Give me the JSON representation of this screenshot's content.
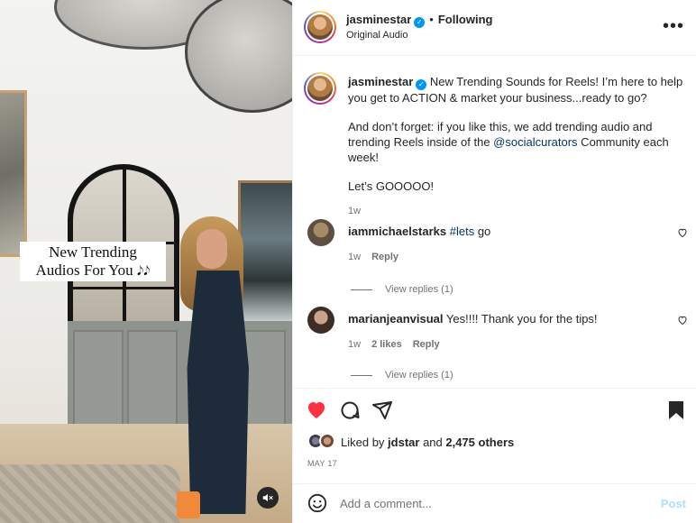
{
  "media": {
    "overlay_caption_line1": "New Trending",
    "overlay_caption_line2": "Audios For You",
    "overlay_caption_notes": "𝅘𝅥𝅮𝅘𝅥𝅮",
    "mute_icon": "speaker-muted-icon"
  },
  "header": {
    "username": "jasminestar",
    "verified": true,
    "separator": "•",
    "follow_status": "Following",
    "audio_label": "Original Audio",
    "more_icon": "•••"
  },
  "caption": {
    "username": "jasminestar",
    "line1": "New Trending Sounds for Reels! I’m here to help you get to ACTION & market your business...ready to go?",
    "line2_before": "And don’t forget: if you like this, we add trending audio and trending Reels inside of the ",
    "line2_mention": "@socialcurators",
    "line2_after": " Community each week!",
    "line3": "Let’s GOOOOO!",
    "time": "1w"
  },
  "comments": [
    {
      "username": "iammichaelstarks",
      "hashtag": "#lets",
      "text": " go",
      "time": "1w",
      "likes": "",
      "reply_label": "Reply",
      "view_replies": "View replies (1)",
      "avatar_color": "#7a6a52"
    },
    {
      "username": "marianjeanvisual",
      "hashtag": "",
      "text": "Yes!!!! Thank you for the tips!",
      "time": "1w",
      "likes": "2 likes",
      "reply_label": "Reply",
      "view_replies": "View replies (1)",
      "avatar_color": "#5a4639"
    }
  ],
  "actions": {
    "liked": true,
    "like_color": "#ff3040",
    "icons": [
      "heart-icon",
      "comment-icon",
      "share-icon",
      "bookmark-icon"
    ]
  },
  "likes": {
    "prefix": "Liked by ",
    "user": "jdstar",
    "middle": " and ",
    "count": "2,475 others"
  },
  "date": "MAY 17",
  "comment_input": {
    "placeholder": "Add a comment...",
    "post_label": "Post"
  }
}
